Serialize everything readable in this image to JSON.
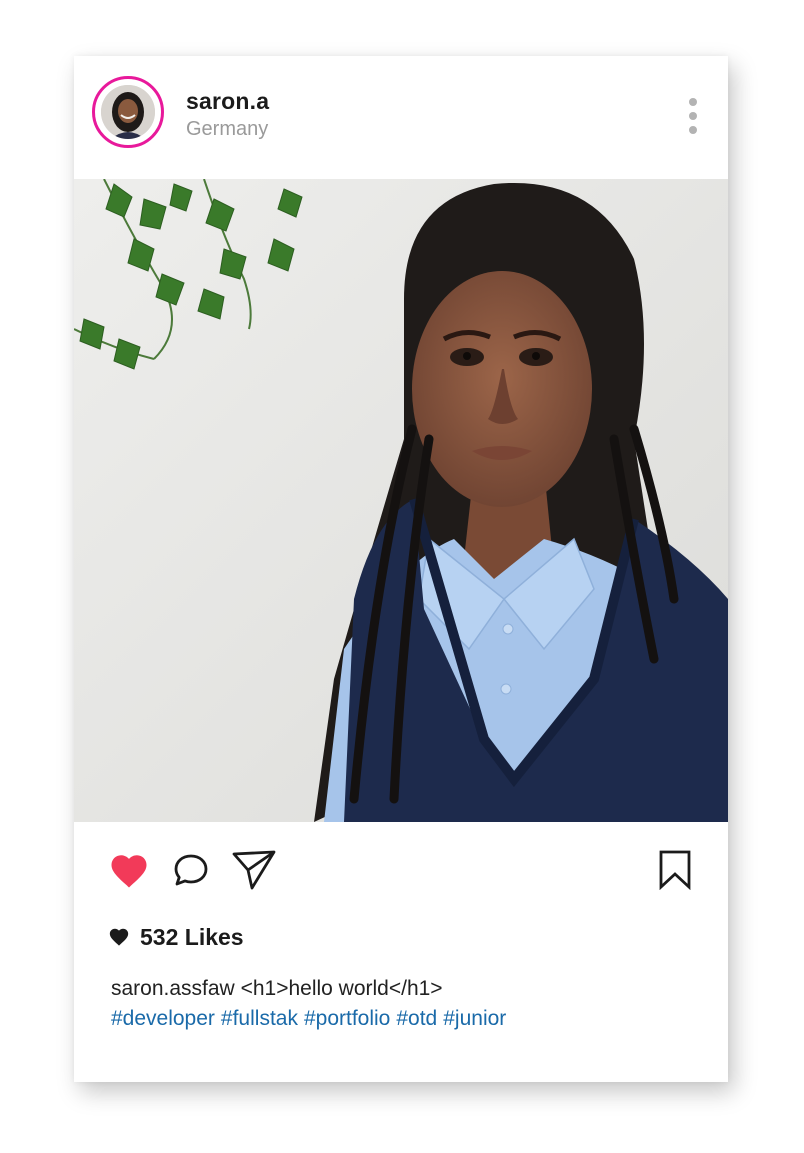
{
  "post": {
    "username": "saron.a",
    "location": "Germany",
    "likes_count": 532,
    "likes_label": "532 Likes",
    "caption_user": "saron.assfaw",
    "caption_text": "<h1>hello world</h1>",
    "hashtags": [
      "#developer",
      "#fullstak",
      "#portfolio",
      "#otd",
      "#junior"
    ],
    "liked": true
  },
  "icons": {
    "like": "heart-icon",
    "comment": "comment-bubble-icon",
    "share": "paper-plane-icon",
    "save": "bookmark-icon",
    "more": "vertical-ellipsis-icon",
    "likes_small": "small-heart-icon"
  },
  "colors": {
    "story_ring": "#e8199b",
    "like_active": "#f23a59",
    "hashtag": "#1a6aa9",
    "text_primary": "#1b1b1b",
    "text_secondary": "#9a9a9a"
  }
}
